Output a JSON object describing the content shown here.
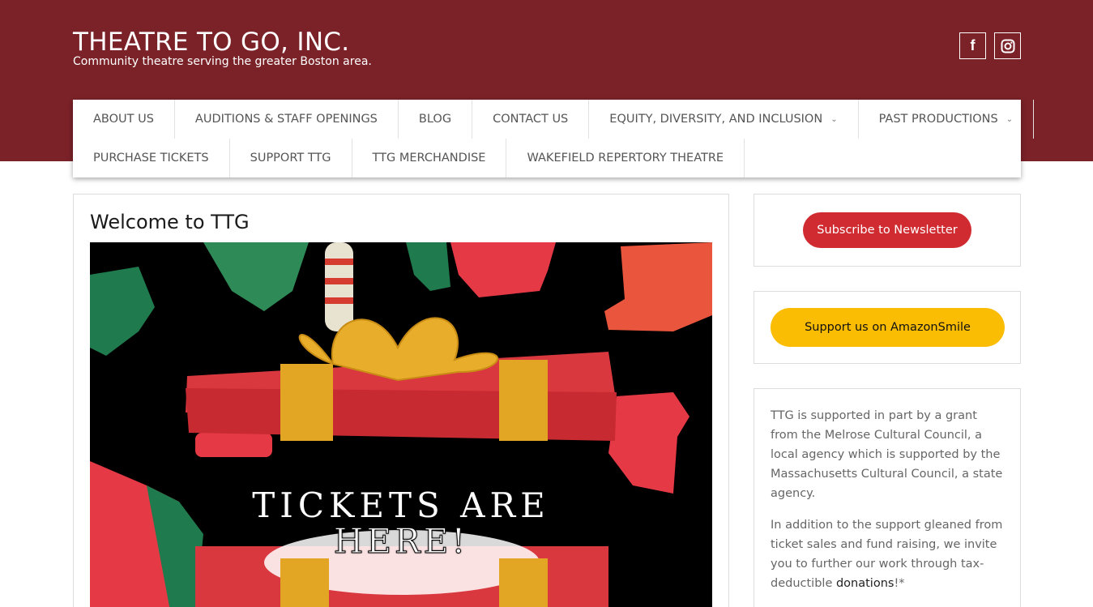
{
  "header": {
    "site_title": "THEATRE TO GO, INC.",
    "tagline": "Community theatre serving the greater Boston area.",
    "social": [
      {
        "icon": "facebook-icon",
        "glyph": "f"
      },
      {
        "icon": "instagram-icon"
      }
    ]
  },
  "nav": {
    "row1": [
      {
        "label": "ABOUT US"
      },
      {
        "label": "AUDITIONS & STAFF OPENINGS"
      },
      {
        "label": "BLOG"
      },
      {
        "label": "CONTACT US"
      },
      {
        "label": "EQUITY, DIVERSITY, AND INCLUSION",
        "has_dropdown": true
      },
      {
        "label": "PAST PRODUCTIONS",
        "has_dropdown": true
      }
    ],
    "row2": [
      {
        "label": "PURCHASE TICKETS"
      },
      {
        "label": "SUPPORT TTG"
      },
      {
        "label": "TTG MERCHANDISE"
      },
      {
        "label": "WAKEFIELD REPERTORY THEATRE"
      }
    ]
  },
  "main": {
    "title": "Welcome to TTG",
    "hero": {
      "line1": "TICKETS ARE",
      "line2": "HERE!"
    }
  },
  "sidebar": {
    "newsletter_button": "Subscribe to Newsletter",
    "amazon_button": "Support us on AmazonSmile",
    "grant_text": "TTG is supported in part by a grant from the Melrose Cultural Council, a local agency which is supported by the Massachusetts Cultural Council, a state agency.",
    "support_text_before": "In addition to the support gleaned from ticket sales and fund raising, we invite you to further our work through tax-deductible ",
    "support_link": "donations",
    "support_text_after": "!*"
  },
  "colors": {
    "header_bg": "#7a2228",
    "newsletter_button": "#d02b30",
    "amazon_button": "#fbbc04"
  }
}
